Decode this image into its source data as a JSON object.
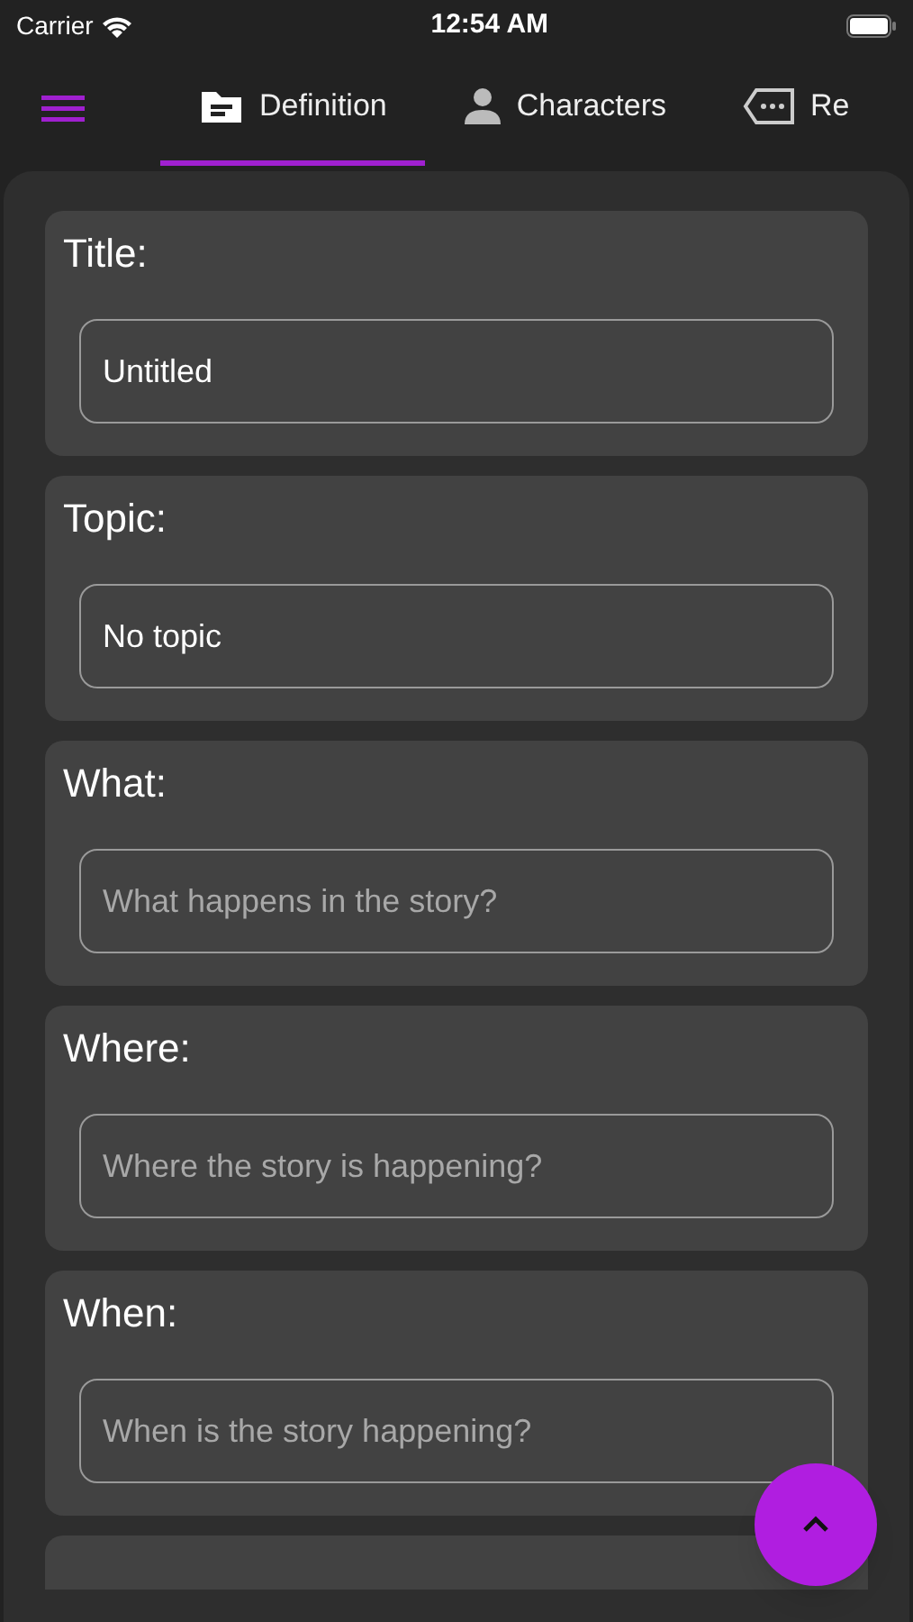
{
  "status_bar": {
    "carrier": "Carrier",
    "time": "12:54 AM"
  },
  "tabs": [
    {
      "label": "Definition",
      "selected": true
    },
    {
      "label": "Characters",
      "selected": false
    },
    {
      "label": "Re",
      "selected": false
    }
  ],
  "cards": [
    {
      "label": "Title:",
      "value": "Untitled"
    },
    {
      "label": "Topic:",
      "value": "No topic"
    },
    {
      "label": "What:",
      "placeholder": "What happens in the story?"
    },
    {
      "label": "Where:",
      "placeholder": "Where the story is happening?"
    },
    {
      "label": "When:",
      "placeholder": "When is the story happening?"
    }
  ]
}
